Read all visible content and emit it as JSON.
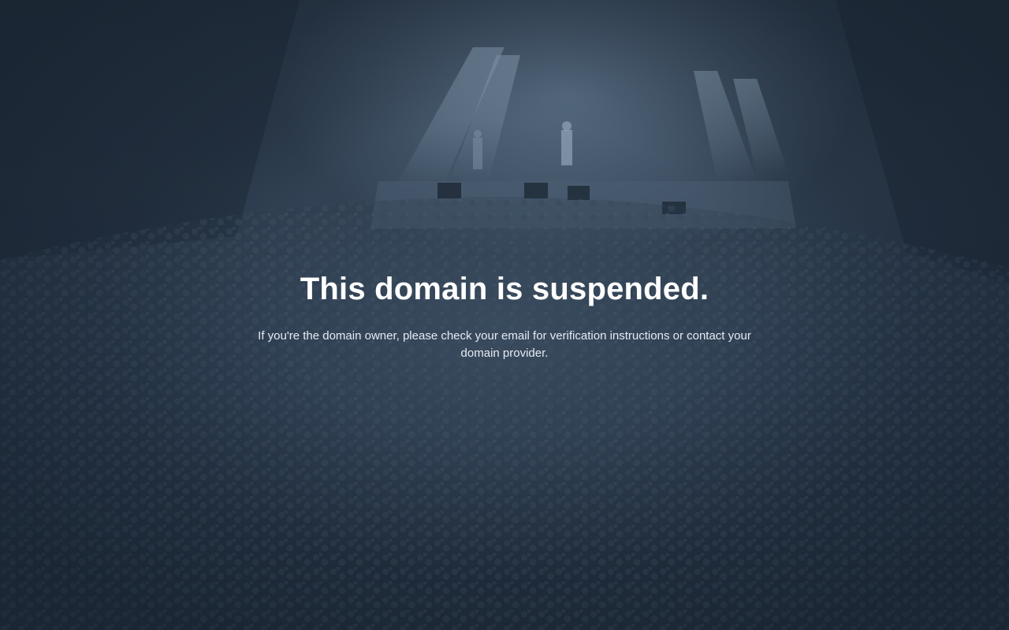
{
  "page": {
    "heading": "This domain is suspended.",
    "message": "If you're the domain owner, please check your email for verification instructions or contact your domain provider."
  },
  "background": {
    "subject": "concert crowd in front of a lit stage",
    "tint": "#243345"
  }
}
